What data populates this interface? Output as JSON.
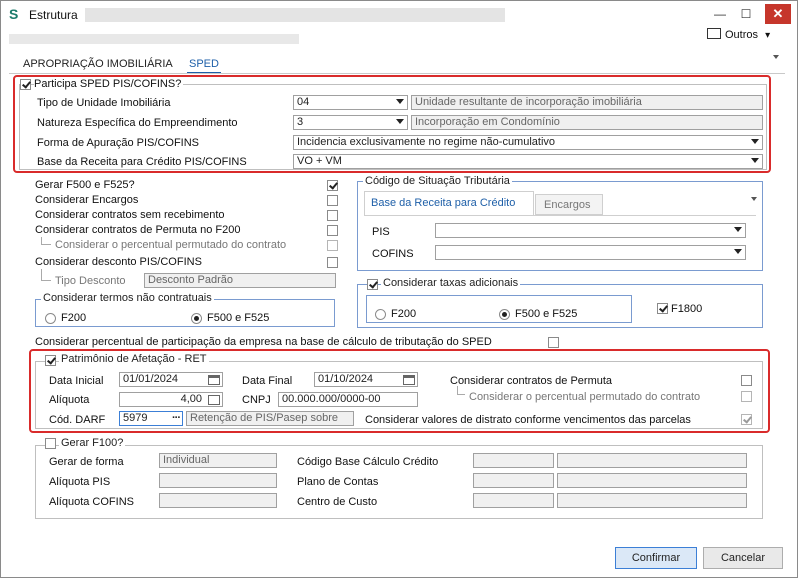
{
  "window": {
    "title": "Estrutura",
    "minimize": "—",
    "maximize": "☐",
    "close": "✕",
    "app_icon": "S"
  },
  "toolbar": {
    "outros_label": "Outros",
    "outros_icon": "list-icon",
    "outros_arrow": "▾"
  },
  "tabs": [
    {
      "label": "APROPRIAÇÃO IMOBILIÁRIA",
      "active": false
    },
    {
      "label": "SPED",
      "active": true
    }
  ],
  "sped": {
    "participa_label": "Participa SPED PIS/COFINS?",
    "participa_checked": true,
    "tipo_unidade": {
      "label": "Tipo de Unidade Imobiliária",
      "code": "04",
      "desc": "Unidade resultante de incorporação imobiliária"
    },
    "natureza": {
      "label": "Natureza Específica do Empreendimento",
      "code": "3",
      "desc": "Incorporação em Condomínio"
    },
    "forma_apuracao": {
      "label": "Forma de Apuração PIS/COFINS",
      "value": "Incidencia exclusivamente no regime não-cumulativo"
    },
    "base_receita": {
      "label": "Base da Receita para Crédito PIS/COFINS",
      "value": "VO + VM"
    }
  },
  "left_options": {
    "gerar_f500": {
      "label": "Gerar F500 e F525?",
      "checked": true
    },
    "encargos": {
      "label": "Considerar Encargos",
      "checked": false
    },
    "sem_recebimento": {
      "label": "Considerar contratos sem recebimento",
      "checked": false
    },
    "permuta_f200": {
      "label": "Considerar contratos de Permuta no F200",
      "checked": false
    },
    "percentual_permutado": {
      "label": "Considerar o percentual permutado do contrato",
      "checked": false
    },
    "desconto": {
      "label": "Considerar desconto PIS/COFINS",
      "checked": false
    },
    "tipo_desconto": {
      "label": "Tipo Desconto",
      "value": "Desconto Padrão"
    },
    "termos": {
      "title": "Considerar termos não contratuais",
      "f200": "F200",
      "f500": "F500 e F525",
      "selected": "F500 e F525"
    }
  },
  "cst": {
    "title": "Código de Situação Tributária",
    "tab_base": "Base da Receita para Crédito",
    "tab_encargos": "Encargos",
    "pis_label": "PIS",
    "pis_value": "",
    "cofins_label": "COFINS",
    "cofins_value": ""
  },
  "taxas": {
    "label": "Considerar taxas adicionais",
    "checked": true,
    "f200": "F200",
    "f500": "F500 e F525",
    "selected": "F500 e F525",
    "f1800_label": "F1800",
    "f1800_checked": true
  },
  "percentual_participacao": {
    "label": "Considerar percentual de participação da empresa na base de cálculo de tributação do SPED",
    "checked": false
  },
  "ret": {
    "label": "Patrimônio de Afetação - RET",
    "checked": true,
    "data_inicial_label": "Data Inicial",
    "data_inicial": "01/01/2024",
    "data_final_label": "Data Final",
    "data_final": "01/10/2024",
    "aliquota_label": "Alíquota",
    "aliquota": "4,00",
    "cnpj_label": "CNPJ",
    "cnpj": "00.000.000/0000-00",
    "darf_label": "Cód. DARF",
    "darf": "5979",
    "darf_dots": "···",
    "darf_desc": "Retenção de PIS/Pasep sobre",
    "permuta_label": "Considerar contratos de Permuta",
    "permuta_checked": false,
    "percentual_label": "Considerar o percentual permutado do contrato",
    "percentual_checked": false,
    "distrato_label": "Considerar valores de distrato  conforme vencimentos das parcelas",
    "distrato_checked": true
  },
  "f100": {
    "label": "Gerar F100?",
    "checked": false,
    "gerar_forma_label": "Gerar de forma",
    "gerar_forma": "Individual",
    "aliquota_pis_label": "Alíquota PIS",
    "aliquota_cofins_label": "Alíquota COFINS",
    "codigo_base_label": "Código Base Cálculo Crédito",
    "plano_contas_label": "Plano de Contas",
    "centro_custo_label": "Centro de Custo"
  },
  "buttons": {
    "confirmar": "Confirmar",
    "cancelar": "Cancelar"
  },
  "colors": {
    "highlight": "#d92b2b",
    "accent": "#1e5fa8"
  }
}
